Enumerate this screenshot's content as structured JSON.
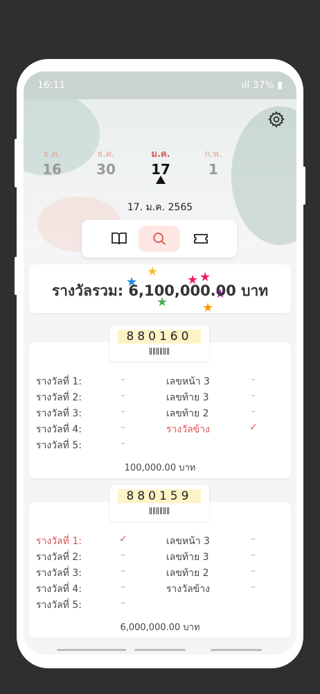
{
  "status_bar": {
    "time": "16:11",
    "battery": "37%"
  },
  "months": [
    {
      "month": "ธ.ค.",
      "day": "16"
    },
    {
      "month": "ธ.ค.",
      "day": "30"
    },
    {
      "month": "ม.ค.",
      "day": "17"
    },
    {
      "month": "ก.พ.",
      "day": "1"
    }
  ],
  "selected_date": "17. ม.ค. 2565",
  "total_prize": "รางวัลรวม: 6,100,000.00 บาท",
  "tickets": [
    {
      "number": "880160",
      "rows_left": [
        "รางวัลที่ 1:",
        "รางวัลที่ 2:",
        "รางวัลที่ 3:",
        "รางวัลที่ 4:",
        "รางวัลที่ 5:"
      ],
      "rows_right": [
        "เลขหน้า 3",
        "เลขท้าย 3",
        "เลขท้าย 2",
        "รางวัลข้าง"
      ],
      "amount": "100,000.00  บาท"
    },
    {
      "number": "880159",
      "rows_left": [
        "รางวัลที่ 1:",
        "รางวัลที่ 2:",
        "รางวัลที่ 3:",
        "รางวัลที่ 4:",
        "รางวัลที่ 5:"
      ],
      "rows_right": [
        "เลขหน้า 3",
        "เลขท้าย 3",
        "เลขท้าย 2",
        "รางวัลข้าง"
      ],
      "amount": "6,000,000.00  บาท"
    }
  ],
  "icons": {
    "settings": "gear-icon",
    "book": "book-icon",
    "search": "search-icon",
    "ticket": "ticket-icon",
    "check": "check-icon"
  },
  "colors": {
    "accent": "#d9534f",
    "ticket_bg": "#fdf3c7",
    "active_tab": "#fde7e5"
  }
}
